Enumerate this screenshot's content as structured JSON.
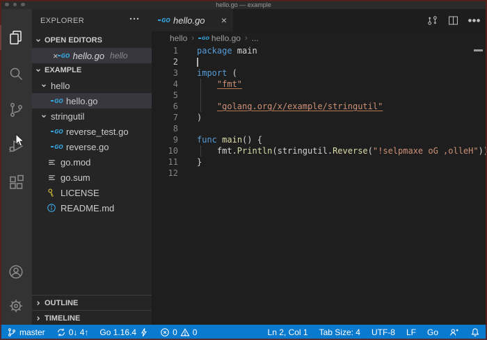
{
  "window": {
    "title": "hello.go — example"
  },
  "activity_bar": {
    "items": [
      {
        "icon": "files-icon",
        "active": true
      },
      {
        "icon": "search-icon"
      },
      {
        "icon": "source-control-icon"
      },
      {
        "icon": "run-debug-icon"
      },
      {
        "icon": "extensions-icon"
      }
    ],
    "bottom": [
      {
        "icon": "account-icon"
      },
      {
        "icon": "settings-gear-icon"
      }
    ]
  },
  "explorer": {
    "title": "EXPLORER"
  },
  "open_editors": {
    "header": "OPEN EDITORS",
    "file": "hello.go",
    "description": "hello"
  },
  "tree": {
    "header": "EXAMPLE",
    "items": [
      {
        "label": "hello",
        "type": "folder",
        "expanded": true
      },
      {
        "label": "hello.go",
        "type": "go-file",
        "selected": true
      },
      {
        "label": "stringutil",
        "type": "folder",
        "expanded": true
      },
      {
        "label": "reverse_test.go",
        "type": "go-file"
      },
      {
        "label": "reverse.go",
        "type": "go-file"
      },
      {
        "label": "go.mod",
        "type": "mod-file"
      },
      {
        "label": "go.sum",
        "type": "mod-file"
      },
      {
        "label": "LICENSE",
        "type": "license-file"
      },
      {
        "label": "README.md",
        "type": "readme-file"
      }
    ]
  },
  "panels": {
    "outline": "OUTLINE",
    "timeline": "TIMELINE"
  },
  "tab": {
    "label": "hello.go"
  },
  "breadcrumb": {
    "items": [
      "hello",
      "hello.go",
      "..."
    ]
  },
  "icons": {
    "go_glyph": "GO",
    "close_glyph": "×"
  },
  "code": {
    "active_line": 2,
    "lines": [
      {
        "n": "1",
        "parts": [
          [
            "kw",
            "package"
          ],
          [
            "pl",
            " main"
          ]
        ]
      },
      {
        "n": "2",
        "parts": []
      },
      {
        "n": "3",
        "parts": [
          [
            "kw",
            "import"
          ],
          [
            "pl",
            " ("
          ]
        ]
      },
      {
        "n": "4",
        "parts": [
          [
            "pl",
            "    "
          ],
          [
            "strl",
            "\"fmt\""
          ]
        ]
      },
      {
        "n": "5",
        "parts": []
      },
      {
        "n": "6",
        "parts": [
          [
            "pl",
            "    "
          ],
          [
            "strl",
            "\"golang.org/x/example/stringutil\""
          ]
        ]
      },
      {
        "n": "7",
        "parts": [
          [
            "pl",
            ")"
          ]
        ]
      },
      {
        "n": "8",
        "parts": []
      },
      {
        "n": "9",
        "parts": [
          [
            "kw",
            "func"
          ],
          [
            "pl",
            " "
          ],
          [
            "fn",
            "main"
          ],
          [
            "pl",
            "() {"
          ]
        ]
      },
      {
        "n": "10",
        "parts": [
          [
            "pl",
            "    fmt."
          ],
          [
            "fn",
            "Println"
          ],
          [
            "pl",
            "(stringutil."
          ],
          [
            "fn",
            "Reverse"
          ],
          [
            "pl",
            "("
          ],
          [
            "str",
            "\"!selpmaxe oG ,olleH\""
          ],
          [
            "pl",
            "))"
          ]
        ]
      },
      {
        "n": "11",
        "parts": [
          [
            "pl",
            "}"
          ]
        ]
      },
      {
        "n": "12",
        "parts": []
      }
    ]
  },
  "status_bar": {
    "branch": "master",
    "sync": "0↓ 4↑",
    "go_version": "Go 1.16.4",
    "errors": "0",
    "warnings": "0",
    "line_col": "Ln 2, Col 1",
    "tab_size": "Tab Size: 4",
    "encoding": "UTF-8",
    "eol": "LF",
    "language": "Go"
  },
  "colors": {
    "status_bar": "#0a7acf",
    "go_icon_blue": "#35a6dd",
    "keyword": "#569cd6",
    "string": "#ce9178",
    "function": "#dcdcaa",
    "sidebar_bg": "#252526",
    "editor_bg": "#1e1e1e",
    "activity_bar_bg": "#333333"
  }
}
